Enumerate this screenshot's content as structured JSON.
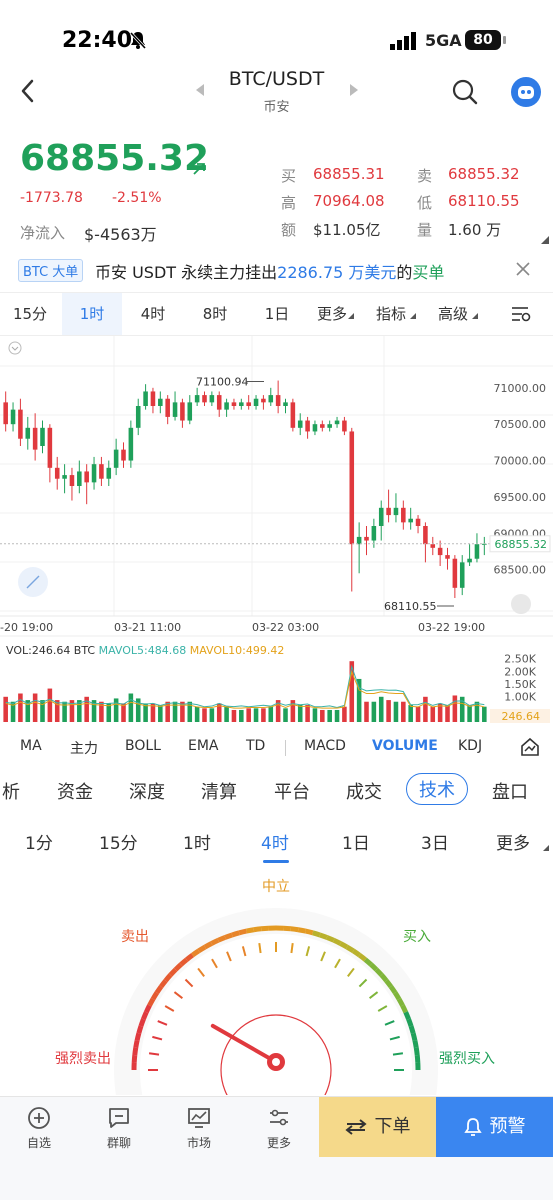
{
  "status": {
    "time": "22:40",
    "network": "5GA",
    "battery": "80"
  },
  "header": {
    "pair": "BTC/USDT",
    "exchange": "币安"
  },
  "ticker": {
    "price": "68855.32",
    "change": "-1773.78",
    "change_pct": "-2.51%",
    "net_inflow_label": "净流入",
    "net_inflow": "$-4563万",
    "buy_label": "买",
    "buy": "68855.31",
    "sell_label": "卖",
    "sell": "68855.32",
    "high_label": "高",
    "high": "70964.08",
    "low_label": "低",
    "low": "68110.55",
    "amount_label": "额",
    "amount": "$11.05亿",
    "volume_label": "量",
    "volume": "1.60 万"
  },
  "banner": {
    "tag": "BTC 大单",
    "part1": "币安 USDT 永续主力挂出",
    "amount": "2286.75 万美元",
    "part2": "的",
    "action": "买单"
  },
  "timeframes": [
    "15分",
    "1时",
    "4时",
    "8时",
    "1日",
    "更多",
    "指标",
    "高级"
  ],
  "active_timeframe": "1时",
  "chart_data": {
    "type": "candlestick",
    "y_ticks": [
      "71000.00",
      "70500.00",
      "70000.00",
      "69500.00",
      "69000.00",
      "68500.00"
    ],
    "x_ticks": [
      "-20 19:00",
      "03-21 11:00",
      "03-22 03:00",
      "03-22 19:00"
    ],
    "high_marker": "71100.94",
    "low_marker": "68110.55",
    "current_price": "68855.32",
    "volume_header": "VOL:246.64 BTC",
    "mavol5": "MAVOL5:484.68",
    "mavol10": "MAVOL10:499.42",
    "volume_ticks": [
      "2.50K",
      "2.00K",
      "1.50K",
      "1.00K"
    ],
    "volume_current": "246.64",
    "candles": [
      {
        "o": 70800,
        "c": 70500,
        "h": 70950,
        "l": 70400
      },
      {
        "o": 70500,
        "c": 70700,
        "h": 70800,
        "l": 70400
      },
      {
        "o": 70700,
        "c": 70300,
        "h": 70850,
        "l": 70200
      },
      {
        "o": 70300,
        "c": 70450,
        "h": 70600,
        "l": 70150
      },
      {
        "o": 70450,
        "c": 70150,
        "h": 70650,
        "l": 70000
      },
      {
        "o": 70200,
        "c": 70450,
        "h": 70550,
        "l": 70100
      },
      {
        "o": 70450,
        "c": 69900,
        "h": 70500,
        "l": 69700
      },
      {
        "o": 69900,
        "c": 69750,
        "h": 70050,
        "l": 69600
      },
      {
        "o": 69750,
        "c": 69800,
        "h": 69950,
        "l": 69550
      },
      {
        "o": 69800,
        "c": 69650,
        "h": 69900,
        "l": 69450
      },
      {
        "o": 69650,
        "c": 69850,
        "h": 70000,
        "l": 69550
      },
      {
        "o": 69850,
        "c": 69700,
        "h": 69950,
        "l": 69400
      },
      {
        "o": 69700,
        "c": 69950,
        "h": 70050,
        "l": 69600
      },
      {
        "o": 69950,
        "c": 69750,
        "h": 70050,
        "l": 69650
      },
      {
        "o": 69750,
        "c": 69900,
        "h": 70000,
        "l": 69650
      },
      {
        "o": 69900,
        "c": 70150,
        "h": 70300,
        "l": 69800
      },
      {
        "o": 70150,
        "c": 70000,
        "h": 70250,
        "l": 69900
      },
      {
        "o": 70000,
        "c": 70450,
        "h": 70550,
        "l": 69900
      },
      {
        "o": 70450,
        "c": 70750,
        "h": 70850,
        "l": 70350
      },
      {
        "o": 70750,
        "c": 70950,
        "h": 71050,
        "l": 70700
      },
      {
        "o": 70950,
        "c": 70750,
        "h": 71000,
        "l": 70650
      },
      {
        "o": 70750,
        "c": 70850,
        "h": 70950,
        "l": 70650
      },
      {
        "o": 70850,
        "c": 70600,
        "h": 70900,
        "l": 70500
      },
      {
        "o": 70600,
        "c": 70800,
        "h": 70950,
        "l": 70550
      },
      {
        "o": 70800,
        "c": 70550,
        "h": 70850,
        "l": 70450
      },
      {
        "o": 70550,
        "c": 70800,
        "h": 70900,
        "l": 70500
      },
      {
        "o": 70800,
        "c": 70900,
        "h": 71000,
        "l": 70750
      },
      {
        "o": 70900,
        "c": 70800,
        "h": 70950,
        "l": 70750
      },
      {
        "o": 70800,
        "c": 70900,
        "h": 70950,
        "l": 70750
      },
      {
        "o": 70900,
        "c": 70700,
        "h": 70950,
        "l": 70600
      },
      {
        "o": 70700,
        "c": 70800,
        "h": 70850,
        "l": 70600
      },
      {
        "o": 70800,
        "c": 70750,
        "h": 70850,
        "l": 70700
      },
      {
        "o": 70750,
        "c": 70800,
        "h": 70850,
        "l": 70700
      },
      {
        "o": 70800,
        "c": 70750,
        "h": 70900,
        "l": 70700
      },
      {
        "o": 70750,
        "c": 70850,
        "h": 70900,
        "l": 70700
      },
      {
        "o": 70850,
        "c": 70800,
        "h": 70900,
        "l": 70700
      },
      {
        "o": 70800,
        "c": 70900,
        "h": 71000,
        "l": 70750
      },
      {
        "o": 70900,
        "c": 70750,
        "h": 71100,
        "l": 70650
      },
      {
        "o": 70750,
        "c": 70800,
        "h": 70850,
        "l": 70650
      },
      {
        "o": 70800,
        "c": 70450,
        "h": 70850,
        "l": 70400
      },
      {
        "o": 70450,
        "c": 70550,
        "h": 70650,
        "l": 70350
      },
      {
        "o": 70550,
        "c": 70400,
        "h": 70600,
        "l": 70300
      },
      {
        "o": 70400,
        "c": 70500,
        "h": 70550,
        "l": 70350
      },
      {
        "o": 70500,
        "c": 70450,
        "h": 70550,
        "l": 70400
      },
      {
        "o": 70450,
        "c": 70500,
        "h": 70550,
        "l": 70400
      },
      {
        "o": 70500,
        "c": 70550,
        "h": 70600,
        "l": 70450
      },
      {
        "o": 70550,
        "c": 70400,
        "h": 70600,
        "l": 70350
      },
      {
        "o": 70400,
        "c": 68850,
        "h": 70450,
        "l": 68200
      },
      {
        "o": 68850,
        "c": 68950,
        "h": 69150,
        "l": 68450
      },
      {
        "o": 68950,
        "c": 68900,
        "h": 69100,
        "l": 68700
      },
      {
        "o": 68900,
        "c": 69100,
        "h": 69200,
        "l": 68800
      },
      {
        "o": 69100,
        "c": 69350,
        "h": 69450,
        "l": 68900
      },
      {
        "o": 69350,
        "c": 69250,
        "h": 69600,
        "l": 69150
      },
      {
        "o": 69250,
        "c": 69350,
        "h": 69550,
        "l": 69150
      },
      {
        "o": 69350,
        "c": 69150,
        "h": 69450,
        "l": 69050
      },
      {
        "o": 69150,
        "c": 69200,
        "h": 69350,
        "l": 69050
      },
      {
        "o": 69200,
        "c": 69100,
        "h": 69250,
        "l": 69000
      },
      {
        "o": 69100,
        "c": 68850,
        "h": 69150,
        "l": 68600
      },
      {
        "o": 68850,
        "c": 68800,
        "h": 68950,
        "l": 68700
      },
      {
        "o": 68800,
        "c": 68700,
        "h": 68900,
        "l": 68550
      },
      {
        "o": 68700,
        "c": 68650,
        "h": 68800,
        "l": 68500
      },
      {
        "o": 68650,
        "c": 68250,
        "h": 68700,
        "l": 68110
      },
      {
        "o": 68250,
        "c": 68600,
        "h": 68700,
        "l": 68150
      },
      {
        "o": 68600,
        "c": 68650,
        "h": 68850,
        "l": 68550
      },
      {
        "o": 68650,
        "c": 68850,
        "h": 69000,
        "l": 68600
      },
      {
        "o": 68850,
        "c": 68855,
        "h": 68950,
        "l": 68700
      }
    ],
    "y_range": [
      68000,
      71300
    ]
  },
  "indicators": [
    "MA",
    "主力",
    "BOLL",
    "EMA",
    "TD",
    "MACD",
    "VOLUME",
    "KDJ"
  ],
  "active_indicator": "VOLUME",
  "analysis_tabs": [
    "析",
    "资金",
    "深度",
    "清算",
    "平台",
    "成交",
    "技术",
    "盘口"
  ],
  "active_analysis": "技术",
  "intervals": [
    "1分",
    "15分",
    "1时",
    "4时",
    "1日",
    "3日",
    "更多"
  ],
  "active_interval": "4时",
  "gauge": {
    "neutral": "中立",
    "sell": "卖出",
    "buy": "买入",
    "strong_sell": "强烈卖出",
    "strong_buy": "强烈买入",
    "reading": 0.22
  },
  "bottom_nav": [
    "自选",
    "群聊",
    "市场",
    "更多"
  ],
  "order_button": "下单",
  "alert_button": "预警",
  "colors": {
    "up": "#1fa05a",
    "down": "#e0393e",
    "accent": "#2f7be6"
  }
}
